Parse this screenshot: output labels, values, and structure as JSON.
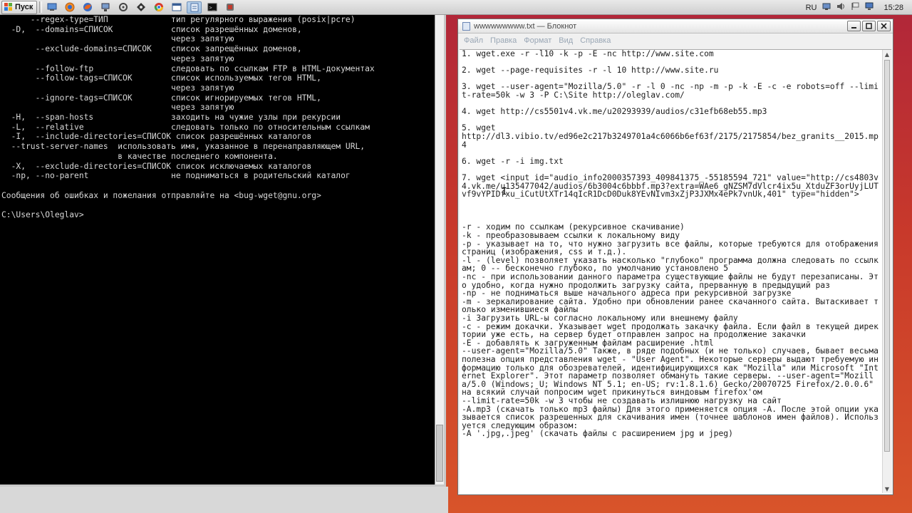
{
  "colors": {
    "console_bg": "#000000",
    "console_fg": "#d8d8d8",
    "desktop_accent": "#c8312f",
    "notepad_bg": "#ffffff"
  },
  "taskbar": {
    "start_label": "Пуск",
    "quicklaunch_icons": [
      "desktop-icon",
      "browser-icon",
      "firefox-icon",
      "network-icon",
      "tool-icon",
      "settings-icon",
      "chrome-icon",
      "window-icon",
      "notepad-icon",
      "console-icon",
      "app-icon"
    ],
    "tray_language": "RU",
    "tray_icons": [
      "network-tray-icon",
      "volume-icon",
      "flag-icon",
      "monitor-icon"
    ],
    "clock": "15:28"
  },
  "console": {
    "lines": [
      "      --regex-type=ТИП             тип регулярного выражения (posix|pcre)",
      "  -D,  --domains=СПИСОК            список разрешённых доменов,",
      "                                   через запятую",
      "       --exclude-domains=СПИСОК    список запрещённых доменов,",
      "                                   через запятую",
      "       --follow-ftp                следовать по ссылкам FTP в HTML-документах",
      "       --follow-tags=СПИСОК        список используемых тегов HTML,",
      "                                   через запятую",
      "       --ignore-tags=СПИСОК        список игнорируемых тегов HTML,",
      "                                   через запятую",
      "  -H,  --span-hosts                заходить на чужие узлы при рекурсии",
      "  -L,  --relative                  следовать только по относительным ссылкам",
      "  -I,  --include-directories=СПИСОК список разрешённых каталогов",
      "  --trust-server-names  использовать имя, указанное в перенаправляющем URL,",
      "                        в качестве последнего компонента.",
      "  -X,  --exclude-directories=СПИСОК список исключаемых каталогов",
      "  -np, --no-parent                 не подниматься в родительский каталог",
      "",
      "Сообщения об ошибках и пожелания отправляйте на <bug-wget@gnu.org>",
      "",
      "C:\\Users\\Oleglav>"
    ]
  },
  "notepad": {
    "title": "wwwwwwwww.txt — Блокнот",
    "menu": [
      "Файл",
      "Правка",
      "Формат",
      "Вид",
      "Справка"
    ],
    "text": "1. wget.exe -r -l10 -k -p -E -nc http://www.site.com\n\n2. wget --page-requisites -r -l 10 http://www.site.ru\n\n3. wget --user-agent=\"Mozilla/5.0\" -r -l 0 -nc -np -m -p -k -E -c -e robots=off --limit-rate=50k -w 3 -P C:\\Site http://oleglav.com/\n\n4. wget http://cs5501v4.vk.me/u20293939/audios/c31efb68eb55.mp3\n\n5. wget\nhttp://dl3.vibio.tv/ed96e2c217b3249701a4c6066b6ef63f/2175/2175854/bez_granits__2015.mp4\n\n6. wget -r -i img.txt\n\n7. wget <input id=\"audio_info2000357393_409841375_-55185594_721\" value=\"http://cs4803v4.vk.me/u135477042/audios/6b3004c6bbbf.mp3?extra=WAe6_gNZSM7dVlcr4ix5u_XtduZF3orUyjLUTvf9vYPIDfxu_iCutUtXTr14qIcR1DcD0Duk8YEvNIvm3xZjP3JXMx4ePk7vnUk,401\" type=\"hidden\">\n\n\n\n-r - ходим по ссылкам (рекурсивное скачивание)\n-k - преобразовываем ссылки к локальному виду\n-p - указывает на то, что нужно загрузить все файлы, которые требуются для отображения страниц (изображения, css и т.д.).\n-l - (level) позволяет указать насколько \"глубоко\" программа должна следовать по ссылкам; 0 -- бесконечно глубоко, по умолчанию установлено 5\n-nc - при использовании данного параметра существующие файлы не будут перезаписаны. Это удобно, когда нужно продолжить загрузку сайта, прерванную в предыдущий раз\n-np - не подниматься выше начального адреса при рекурсивной загрузке\n-m - зеркалирование сайта. Удобно при обновлении ранее скачанного сайта. Вытаскивает только изменившиеся файлы\n-i Загрузить URL-ы согласно локальному или внешнему файлу\n-c - режим докачки. Указывает wget продолжать закачку файла. Если файл в текущей директории уже есть, на сервер будет отправлен запрос на продолжение закачки\n-E - добавлять к загруженным файлам расширение .html\n--user-agent=\"Mozilla/5.0\" Также, в ряде подобных (и не только) случаев, бывает весьма полезна опция представления wget - \"User Agent\". Некоторые серверы выдают требуемую информацию только для обозревателей, идентифицирующихся как \"Mozilla\" или Microsoft \"Internet Explorer\". Этот параметр позволяет обмануть такие серверы. --user-agent=\"Mozilla/5.0 (Windows; U; Windows NT 5.1; en-US; rv:1.8.1.6) Gecko/20070725 Firefox/2.0.0.6\" на всякий случай попросим wget прикинуться виндовым firefox'ом\n--limit-rate=50k -w 3 чтобы не создавать излишнюю нагрузку на сайт\n-A.mp3 (скачать только mp3 файлы) Для этого применяется опция -A. После этой опции указывается список разрешенных для скачивания имен (точнее шаблонов имен файлов). Используется следующим образом:\n-A '.jpg,.jpeg' (скачать файлы с расширением jpg и jpeg)"
  }
}
